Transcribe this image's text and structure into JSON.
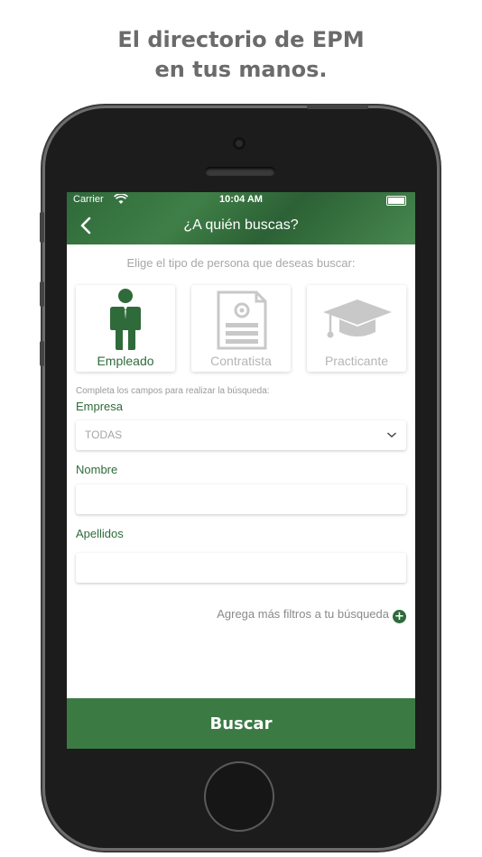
{
  "headline": {
    "line1": "El directorio de EPM",
    "line2": "en tus manos."
  },
  "status_bar": {
    "carrier": "Carrier",
    "time": "10:04 AM"
  },
  "nav": {
    "title": "¿A quién buscas?",
    "back_glyph": "‹"
  },
  "person_type": {
    "prompt": "Elige el tipo de persona que deseas buscar:",
    "options": [
      {
        "label": "Empleado",
        "icon": "employee-icon",
        "selected": true
      },
      {
        "label": "Contratista",
        "icon": "contract-document-icon",
        "selected": false
      },
      {
        "label": "Practicante",
        "icon": "graduation-cap-icon",
        "selected": false
      }
    ]
  },
  "form": {
    "hint": "Completa los campos para realizar la búsqueda:",
    "empresa_label": "Empresa",
    "empresa_value": "TODAS",
    "nombre_label": "Nombre",
    "nombre_value": "",
    "apellidos_label": "Apellidos",
    "apellidos_value": ""
  },
  "more_filters": {
    "label": "Agrega más filtros a tu búsqueda",
    "plus": "+"
  },
  "search_button": {
    "label": "Buscar"
  },
  "colors": {
    "brand_green": "#3c7a44",
    "label_green": "#2f6b3a",
    "muted_gray": "#a7a7a7"
  }
}
